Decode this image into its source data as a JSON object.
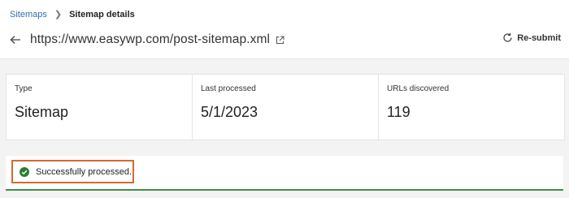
{
  "breadcrumb": {
    "parent": "Sitemaps",
    "current": "Sitemap details"
  },
  "header": {
    "url": "https://www.easywp.com/post-sitemap.xml",
    "resubmit_label": "Re-submit"
  },
  "cards": [
    {
      "label": "Type",
      "value": "Sitemap"
    },
    {
      "label": "Last processed",
      "value": "5/1/2023"
    },
    {
      "label": "URLs discovered",
      "value": "119"
    }
  ],
  "status": {
    "text": "Successfully processed.",
    "color": "#2e7d32",
    "highlight_color": "#d46a30"
  }
}
